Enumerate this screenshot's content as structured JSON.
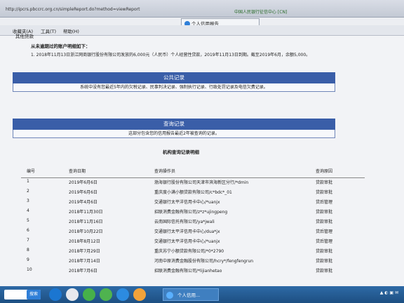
{
  "browser": {
    "url": "http://ipcrs.pbccrc.org.cn/simpleReport.do?method=viewReport",
    "cert_text": "中国人民银行征信中心 [CN]",
    "tab_title": "个人信用报告"
  },
  "menu": {
    "items": [
      "收藏夹(A)",
      "工具(T)",
      "帮助(H)"
    ]
  },
  "report": {
    "cut_heading": "其他贷款",
    "nonzero_title": "从未逾期过的账户明细如下：",
    "nonzero_item": "1.    2018年11月13日浙江网商银行股份有限公司发放的6,000元（人民币）个人经营性贷款，2019年11月13日到期。截至2019年6月，余额5,000。",
    "public_band": "公共记录",
    "public_note": "系统中没有您最近5年内的欠税记录、民事判决记录、强制执行记录、行政处罚记录及电信欠费记录。",
    "query_band": "查询记录",
    "query_note": "这部分包含您的信用报告最近2年被查询的记录。",
    "inst_title": "机构查询记录明细"
  },
  "table": {
    "headers": [
      "编号",
      "查询日期",
      "查询操作员",
      "查询原因"
    ],
    "rows": [
      [
        "1",
        "2019年6月6日",
        "渤海银行股份有限公司天津市滨海新区分行/*dmin",
        "贷款审批"
      ],
      [
        "2",
        "2019年6月6日",
        "重庆度小满小额贷款有限公司/c*bdc*_01",
        "贷款审批"
      ],
      [
        "3",
        "2019年4月6日",
        "交通银行太平洋信用卡中心/*uanjx",
        "贷后管理"
      ],
      [
        "4",
        "2018年11月30日",
        "招联消费金融有限公司/z*z*ujingpeng",
        "贷款审批"
      ],
      [
        "5",
        "2018年11月16日",
        "云南国际信托有限公司/ya*jwali",
        "贷款审批"
      ],
      [
        "6",
        "2018年10月22日",
        "交通银行太平洋信用卡中心/dua*jx",
        "贷后管理"
      ],
      [
        "7",
        "2018年8月12日",
        "交通银行太平洋信用卡中心/*uanjx",
        "贷后管理"
      ],
      [
        "8",
        "2018年7月29日",
        "重庆苏宁小额贷款有限公司/*0*2790",
        "贷款审批"
      ],
      [
        "9",
        "2018年7月14日",
        "河南中原消费金融股份有限公司/hcry*/fengfengrun",
        "贷款审批"
      ],
      [
        "10",
        "2018年7月6日",
        "招联消费金融有限公司/*lijianhetao",
        "贷款审批"
      ]
    ]
  },
  "taskbar": {
    "search_btn": "搜索",
    "active_item": "个人信用..."
  }
}
